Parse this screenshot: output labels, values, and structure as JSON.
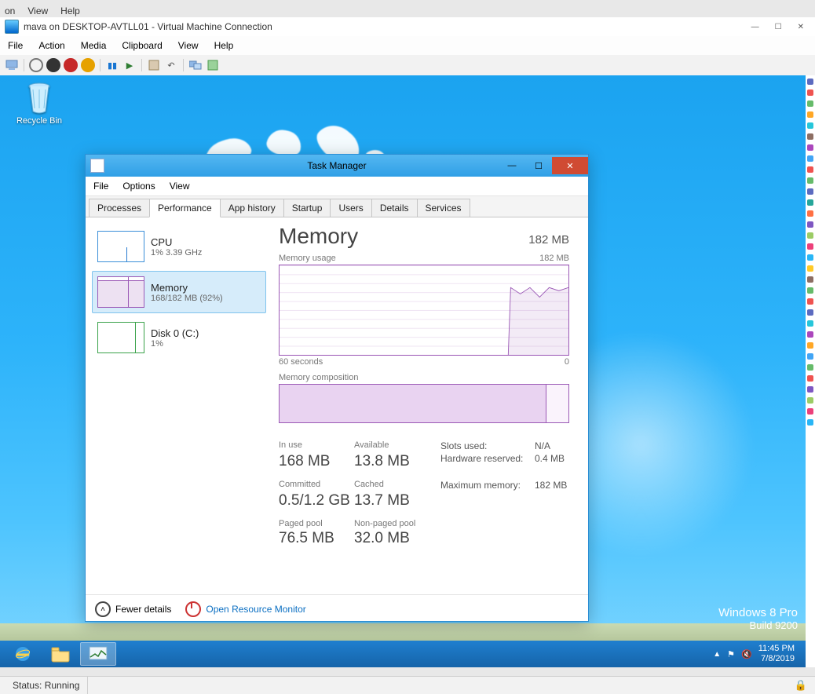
{
  "host_menu_frag": [
    "on",
    "View",
    "Help"
  ],
  "host_window": {
    "title": "mava on DESKTOP-AVTLL01 - Virtual Machine Connection",
    "menu": [
      "File",
      "Action",
      "Media",
      "Clipboard",
      "View",
      "Help"
    ]
  },
  "desktop": {
    "recycle_bin": "Recycle Bin",
    "watermark_line1": "Windows 8 Pro",
    "watermark_line2": "Build 9200"
  },
  "taskmgr": {
    "title": "Task Manager",
    "menu": [
      "File",
      "Options",
      "View"
    ],
    "tabs": [
      "Processes",
      "Performance",
      "App history",
      "Startup",
      "Users",
      "Details",
      "Services"
    ],
    "active_tab_index": 1,
    "side": [
      {
        "name": "CPU",
        "sub": "1% 3.39 GHz"
      },
      {
        "name": "Memory",
        "sub": "168/182 MB (92%)"
      },
      {
        "name": "Disk 0 (C:)",
        "sub": "1%"
      }
    ],
    "active_side_index": 1,
    "main": {
      "heading": "Memory",
      "heading_right": "182 MB",
      "usage_label": "Memory usage",
      "usage_right": "182 MB",
      "axis_left": "60 seconds",
      "axis_right": "0",
      "composition_label": "Memory composition",
      "composition_used_pct": 92,
      "stats": {
        "in_use_lab": "In use",
        "in_use": "168 MB",
        "available_lab": "Available",
        "available": "13.8 MB",
        "committed_lab": "Committed",
        "committed": "0.5/1.2 GB",
        "cached_lab": "Cached",
        "cached": "13.7 MB",
        "paged_lab": "Paged pool",
        "paged": "76.5 MB",
        "nonpaged_lab": "Non-paged pool",
        "nonpaged": "32.0 MB",
        "slots_lab": "Slots used:",
        "slots": "N/A",
        "hw_lab": "Hardware reserved:",
        "hw": "0.4 MB",
        "max_lab": "Maximum memory:",
        "max": "182 MB"
      }
    },
    "footer": {
      "fewer": "Fewer details",
      "monitor": "Open Resource Monitor"
    }
  },
  "systray": {
    "time": "11:45 PM",
    "date": "7/8/2019"
  },
  "status_bar": "Status: Running",
  "chart_data": {
    "type": "line",
    "title": "Memory usage",
    "xlabel": "seconds",
    "ylabel": "MB",
    "xlim": [
      0,
      60
    ],
    "ylim": [
      0,
      182
    ],
    "x": [
      60,
      58,
      56,
      54,
      52,
      50,
      48,
      46,
      44,
      42,
      40,
      38,
      36,
      34,
      32,
      30,
      28,
      26,
      24,
      22,
      20,
      18,
      16,
      14,
      12,
      10,
      8,
      6,
      4,
      2,
      0
    ],
    "y": [
      0,
      0,
      0,
      0,
      0,
      0,
      0,
      0,
      0,
      0,
      0,
      0,
      0,
      0,
      0,
      0,
      0,
      0,
      0,
      0,
      0,
      0,
      0,
      0,
      168,
      164,
      168,
      162,
      168,
      166,
      168
    ]
  }
}
